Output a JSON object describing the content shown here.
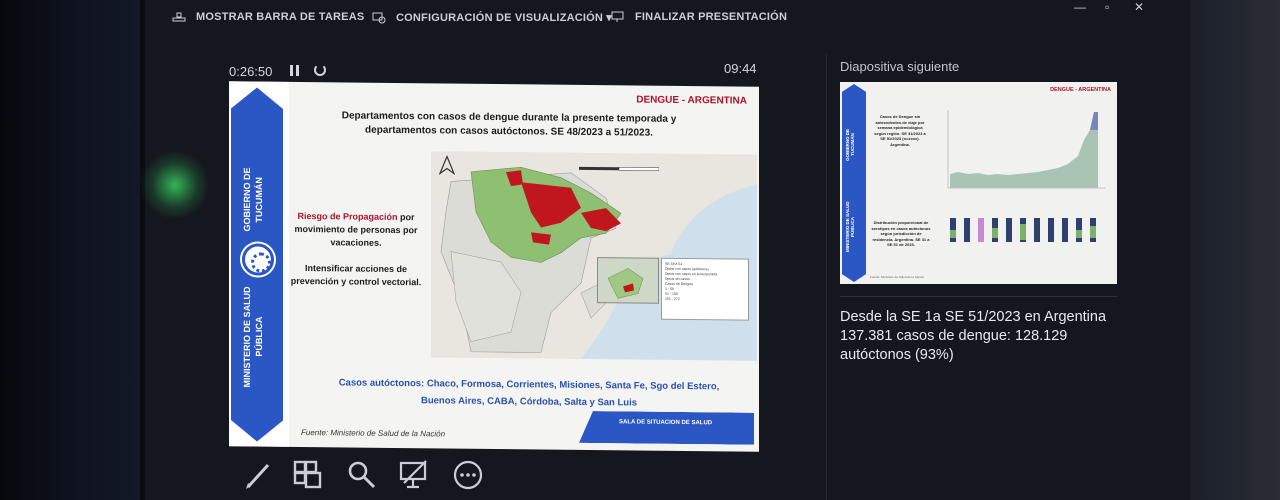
{
  "topbar": {
    "show_taskbar": "MOSTRAR BARRA DE TAREAS",
    "display_settings": "CONFIGURACIÓN DE VISUALIZACIÓN ▾",
    "end_show": "FINALIZAR PRESENTACIÓN",
    "minimize": "—",
    "maximize": "▫",
    "close": "✕"
  },
  "presenter": {
    "elapsed": "0:26:50",
    "clock": "09:44"
  },
  "slide": {
    "tag": "DENGUE - ARGENTINA",
    "title": "Departamentos con casos de dengue durante la presente temporada y departamentos con casos autóctonos. SE 48/2023 a 51/2023.",
    "ribbon_top": "GOBIERNO DE TUCUMÁN",
    "ribbon_bottom": "MINISTERIO DE SALUD PÚBLICA",
    "risk_prefix": "Riesgo de Propagación",
    "risk_rest": " por movimiento de personas por vacaciones.",
    "intensify": "Intensificar acciones de prevención y control vectorial.",
    "cases": "Casos autóctonos: Chaco, Formosa, Corrientes, Misiones, Santa Fe, Sgo del Estero, Buenos Aires, CABA, Córdoba, Salta y San Luis",
    "source": "Fuente: Ministerio de Salud de la Nación",
    "banner": "SALA DE SITUACION DE SALUD",
    "legend": {
      "title": "SE 48 a 51",
      "items": [
        "Dptos con casos autóctonos",
        "Dptos con casos en la temporada",
        "Dptos sin casos",
        "Casos de Dengue",
        "1 - 50",
        "51 - 150",
        "151 - 272"
      ]
    },
    "scale": [
      "0",
      "200",
      "400 km"
    ]
  },
  "next_slide": {
    "label": "Diapositiva siguiente",
    "tag": "DENGUE - ARGENTINA",
    "ribbon_top": "GOBIERNO DE TUCUMÁN",
    "ribbon_bottom": "MINISTERIO DE SALUD PÚBLICA",
    "text1": "Casos de Dengue sin antecedentes de viaje por semana epidemiológica según región. SE 31/2023 a SE 51/2023 (n=xxxx). Argentina.",
    "text2": "Distribución proporcional de serotipos en casos autóctonos según jurisdicción de residencia. Argentina. SE 31 a SE 51 de 2023.",
    "footer": "Fuente: Ministerio de Salud de la Nación"
  },
  "notes": {
    "text": "Desde la SE 1a SE 51/2023 en Argentina 137.381 casos de dengue: 128.129 autóctonos (93%)"
  },
  "icons": [
    "pen-icon",
    "slides-grid-icon",
    "zoom-icon",
    "hide-screen-icon",
    "more-options-icon"
  ],
  "colors": {
    "accent_blue": "#2b57c4",
    "alert_red": "#b0122a",
    "map_green": "#7fb069",
    "map_red": "#c0161e"
  }
}
